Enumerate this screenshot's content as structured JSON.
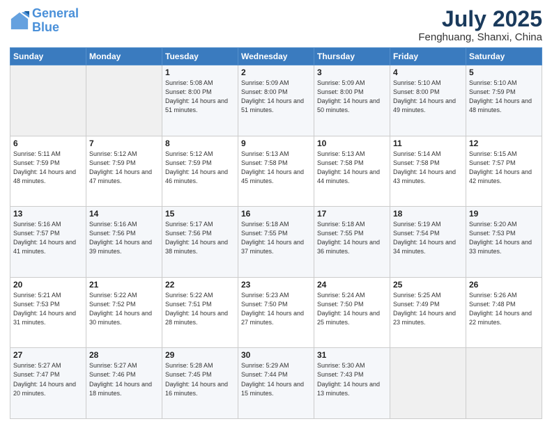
{
  "header": {
    "logo_line1": "General",
    "logo_line2": "Blue",
    "month": "July 2025",
    "location": "Fenghuang, Shanxi, China"
  },
  "weekdays": [
    "Sunday",
    "Monday",
    "Tuesday",
    "Wednesday",
    "Thursday",
    "Friday",
    "Saturday"
  ],
  "weeks": [
    [
      {
        "day": "",
        "info": ""
      },
      {
        "day": "",
        "info": ""
      },
      {
        "day": "1",
        "info": "Sunrise: 5:08 AM\nSunset: 8:00 PM\nDaylight: 14 hours and 51 minutes."
      },
      {
        "day": "2",
        "info": "Sunrise: 5:09 AM\nSunset: 8:00 PM\nDaylight: 14 hours and 51 minutes."
      },
      {
        "day": "3",
        "info": "Sunrise: 5:09 AM\nSunset: 8:00 PM\nDaylight: 14 hours and 50 minutes."
      },
      {
        "day": "4",
        "info": "Sunrise: 5:10 AM\nSunset: 8:00 PM\nDaylight: 14 hours and 49 minutes."
      },
      {
        "day": "5",
        "info": "Sunrise: 5:10 AM\nSunset: 7:59 PM\nDaylight: 14 hours and 48 minutes."
      }
    ],
    [
      {
        "day": "6",
        "info": "Sunrise: 5:11 AM\nSunset: 7:59 PM\nDaylight: 14 hours and 48 minutes."
      },
      {
        "day": "7",
        "info": "Sunrise: 5:12 AM\nSunset: 7:59 PM\nDaylight: 14 hours and 47 minutes."
      },
      {
        "day": "8",
        "info": "Sunrise: 5:12 AM\nSunset: 7:59 PM\nDaylight: 14 hours and 46 minutes."
      },
      {
        "day": "9",
        "info": "Sunrise: 5:13 AM\nSunset: 7:58 PM\nDaylight: 14 hours and 45 minutes."
      },
      {
        "day": "10",
        "info": "Sunrise: 5:13 AM\nSunset: 7:58 PM\nDaylight: 14 hours and 44 minutes."
      },
      {
        "day": "11",
        "info": "Sunrise: 5:14 AM\nSunset: 7:58 PM\nDaylight: 14 hours and 43 minutes."
      },
      {
        "day": "12",
        "info": "Sunrise: 5:15 AM\nSunset: 7:57 PM\nDaylight: 14 hours and 42 minutes."
      }
    ],
    [
      {
        "day": "13",
        "info": "Sunrise: 5:16 AM\nSunset: 7:57 PM\nDaylight: 14 hours and 41 minutes."
      },
      {
        "day": "14",
        "info": "Sunrise: 5:16 AM\nSunset: 7:56 PM\nDaylight: 14 hours and 39 minutes."
      },
      {
        "day": "15",
        "info": "Sunrise: 5:17 AM\nSunset: 7:56 PM\nDaylight: 14 hours and 38 minutes."
      },
      {
        "day": "16",
        "info": "Sunrise: 5:18 AM\nSunset: 7:55 PM\nDaylight: 14 hours and 37 minutes."
      },
      {
        "day": "17",
        "info": "Sunrise: 5:18 AM\nSunset: 7:55 PM\nDaylight: 14 hours and 36 minutes."
      },
      {
        "day": "18",
        "info": "Sunrise: 5:19 AM\nSunset: 7:54 PM\nDaylight: 14 hours and 34 minutes."
      },
      {
        "day": "19",
        "info": "Sunrise: 5:20 AM\nSunset: 7:53 PM\nDaylight: 14 hours and 33 minutes."
      }
    ],
    [
      {
        "day": "20",
        "info": "Sunrise: 5:21 AM\nSunset: 7:53 PM\nDaylight: 14 hours and 31 minutes."
      },
      {
        "day": "21",
        "info": "Sunrise: 5:22 AM\nSunset: 7:52 PM\nDaylight: 14 hours and 30 minutes."
      },
      {
        "day": "22",
        "info": "Sunrise: 5:22 AM\nSunset: 7:51 PM\nDaylight: 14 hours and 28 minutes."
      },
      {
        "day": "23",
        "info": "Sunrise: 5:23 AM\nSunset: 7:50 PM\nDaylight: 14 hours and 27 minutes."
      },
      {
        "day": "24",
        "info": "Sunrise: 5:24 AM\nSunset: 7:50 PM\nDaylight: 14 hours and 25 minutes."
      },
      {
        "day": "25",
        "info": "Sunrise: 5:25 AM\nSunset: 7:49 PM\nDaylight: 14 hours and 23 minutes."
      },
      {
        "day": "26",
        "info": "Sunrise: 5:26 AM\nSunset: 7:48 PM\nDaylight: 14 hours and 22 minutes."
      }
    ],
    [
      {
        "day": "27",
        "info": "Sunrise: 5:27 AM\nSunset: 7:47 PM\nDaylight: 14 hours and 20 minutes."
      },
      {
        "day": "28",
        "info": "Sunrise: 5:27 AM\nSunset: 7:46 PM\nDaylight: 14 hours and 18 minutes."
      },
      {
        "day": "29",
        "info": "Sunrise: 5:28 AM\nSunset: 7:45 PM\nDaylight: 14 hours and 16 minutes."
      },
      {
        "day": "30",
        "info": "Sunrise: 5:29 AM\nSunset: 7:44 PM\nDaylight: 14 hours and 15 minutes."
      },
      {
        "day": "31",
        "info": "Sunrise: 5:30 AM\nSunset: 7:43 PM\nDaylight: 14 hours and 13 minutes."
      },
      {
        "day": "",
        "info": ""
      },
      {
        "day": "",
        "info": ""
      }
    ]
  ]
}
